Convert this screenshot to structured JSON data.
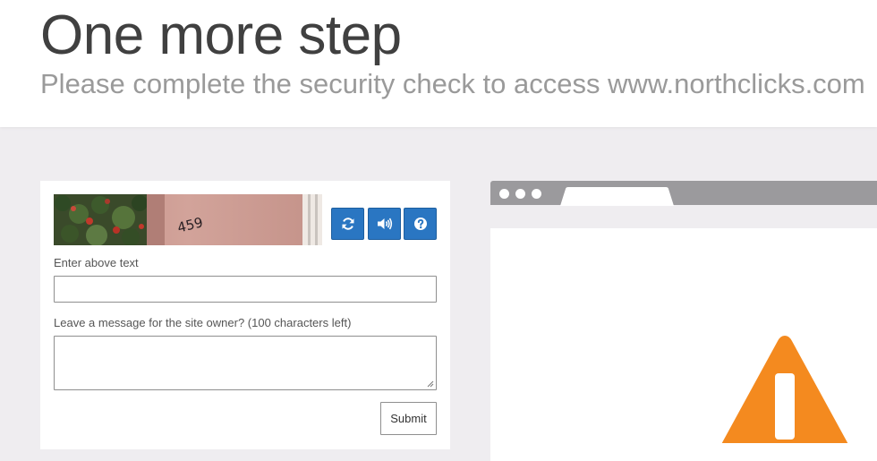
{
  "header": {
    "title": "One more step",
    "subtitle": "Please complete the security check to access www.northclicks.com"
  },
  "captcha": {
    "image_text": "459",
    "refresh_icon": "refresh-icon",
    "audio_icon": "audio-icon",
    "help_icon": "help-icon",
    "input_label": "Enter above text",
    "input_value": "",
    "message_label": "Leave a message for the site owner? (100 characters left)",
    "message_value": "",
    "submit_label": "Submit"
  },
  "illustration": {
    "warning_icon": "warning-icon"
  },
  "colors": {
    "button_blue": "#2a76c2",
    "warning_orange": "#f48a1f",
    "browser_gray": "#9b9a9d",
    "page_background": "#efedf0"
  }
}
